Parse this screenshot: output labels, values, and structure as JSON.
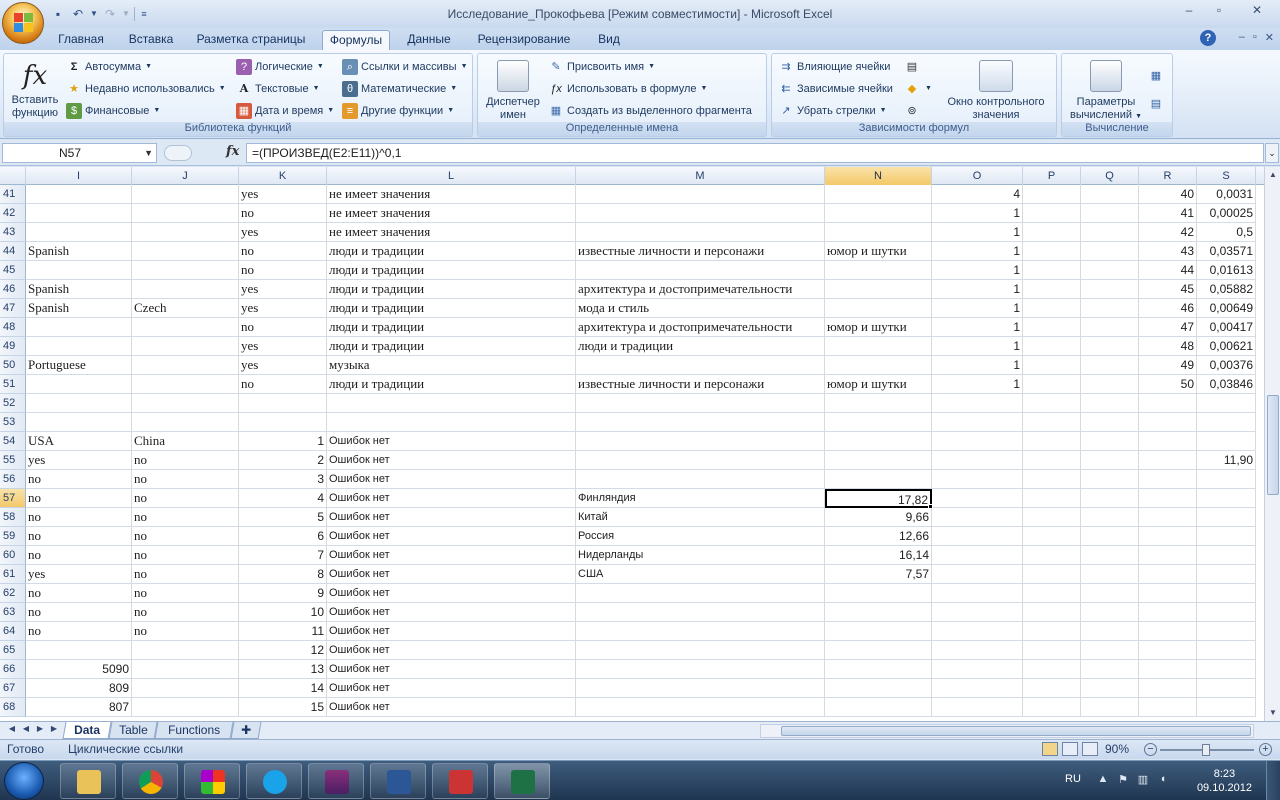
{
  "window": {
    "title": "Исследование_Прокофьева  [Режим совместимости] - Microsoft Excel",
    "controls": [
      "–",
      "▫",
      "✕"
    ]
  },
  "qat": {
    "save": "save-icon",
    "undo": "undo-icon",
    "redo": "redo-icon"
  },
  "tabs": [
    "Главная",
    "Вставка",
    "Разметка страницы",
    "Формулы",
    "Данные",
    "Рецензирование",
    "Вид"
  ],
  "active_tab": "Формулы",
  "ribbon": {
    "func_lib": {
      "label": "Библиотека функций",
      "insert_function": "Вставить функцию",
      "autosum": "Автосумма",
      "recent": "Недавно использовались",
      "financial": "Финансовые",
      "logical": "Логические",
      "text": "Текстовые",
      "datetime": "Дата и время",
      "lookup": "Ссылки и массивы",
      "math": "Математические",
      "other": "Другие функции"
    },
    "names": {
      "label": "Определенные имена",
      "name_manager_1": "Диспетчер",
      "name_manager_2": "имен",
      "define_name": "Присвоить имя",
      "use_in_formula": "Использовать в формуле",
      "create_from_sel": "Создать из выделенного фрагмента"
    },
    "auditing": {
      "label": "Зависимости формул",
      "precedents": "Влияющие ячейки",
      "dependents": "Зависимые ячейки",
      "remove_arrows": "Убрать стрелки",
      "watch_1": "Окно контрольного",
      "watch_2": "значения"
    },
    "calc": {
      "label": "Вычисление",
      "options_1": "Параметры",
      "options_2": "вычислений"
    }
  },
  "formula_bar": {
    "name_box": "N57",
    "formula": "=(ПРОИЗВЕД(E2:E11))^0,1"
  },
  "columns": [
    "I",
    "J",
    "K",
    "L",
    "M",
    "N",
    "O",
    "P",
    "Q",
    "R",
    "S"
  ],
  "selected_column": "N",
  "selected_row": "57",
  "rows": [
    {
      "n": "41",
      "K": "yes",
      "L": "не имеет значения",
      "O": "4",
      "R": "40",
      "S": "0,0031"
    },
    {
      "n": "42",
      "K": "no",
      "L": "не имеет значения",
      "O": "1",
      "R": "41",
      "S": "0,00025"
    },
    {
      "n": "43",
      "K": "yes",
      "L": "не имеет значения",
      "O": "1",
      "R": "42",
      "S": "0,5"
    },
    {
      "n": "44",
      "I": "Spanish",
      "K": "no",
      "L": "люди и традиции",
      "M": "известные личности и персонажи",
      "N": "юмор и шутки",
      "O": "1",
      "R": "43",
      "S": "0,03571"
    },
    {
      "n": "45",
      "K": "no",
      "L": "люди и традиции",
      "O": "1",
      "R": "44",
      "S": "0,01613"
    },
    {
      "n": "46",
      "I": "Spanish",
      "K": "yes",
      "L": "люди и традиции",
      "M": "архитектура и достопримечательности",
      "O": "1",
      "R": "45",
      "S": "0,05882"
    },
    {
      "n": "47",
      "I": "Spanish",
      "J": "Czech",
      "K": "yes",
      "L": "люди и традиции",
      "M": "мода и стиль",
      "O": "1",
      "R": "46",
      "S": "0,00649"
    },
    {
      "n": "48",
      "K": "no",
      "L": "люди и традиции",
      "M": "архитектура и достопримечательности",
      "N": "юмор и шутки",
      "O": "1",
      "R": "47",
      "S": "0,00417"
    },
    {
      "n": "49",
      "K": "yes",
      "L": "люди и традиции",
      "M": "люди и традиции",
      "O": "1",
      "R": "48",
      "S": "0,00621"
    },
    {
      "n": "50",
      "I": "Portuguese",
      "K": "yes",
      "L": "музыка",
      "O": "1",
      "R": "49",
      "S": "0,00376"
    },
    {
      "n": "51",
      "K": "no",
      "L": "люди и традиции",
      "M": "известные личности и персонажи",
      "N": "юмор и шутки",
      "O": "1",
      "R": "50",
      "S": "0,03846"
    },
    {
      "n": "52"
    },
    {
      "n": "53"
    },
    {
      "n": "54",
      "I": "USA",
      "J": "China",
      "K": "1",
      "L": "Ошибок нет"
    },
    {
      "n": "55",
      "I": "yes",
      "J": "no",
      "K": "2",
      "L": "Ошибок нет",
      "S": "11,90"
    },
    {
      "n": "56",
      "I": "no",
      "J": "no",
      "K": "3",
      "L": "Ошибок нет"
    },
    {
      "n": "57",
      "I": "no",
      "J": "no",
      "K": "4",
      "L": "Ошибок нет",
      "M": "Финляндия",
      "N": "17,82"
    },
    {
      "n": "58",
      "I": "no",
      "J": "no",
      "K": "5",
      "L": "Ошибок нет",
      "M": "Китай",
      "N": "9,66"
    },
    {
      "n": "59",
      "I": "no",
      "J": "no",
      "K": "6",
      "L": "Ошибок нет",
      "M": "Россия",
      "N": "12,66"
    },
    {
      "n": "60",
      "I": "no",
      "J": "no",
      "K": "7",
      "L": "Ошибок нет",
      "M": "Нидерланды",
      "N": "16,14"
    },
    {
      "n": "61",
      "I": "yes",
      "J": "no",
      "K": "8",
      "L": "Ошибок нет",
      "M": "США",
      "N": "7,57"
    },
    {
      "n": "62",
      "I": "no",
      "J": "no",
      "K": "9",
      "L": "Ошибок нет"
    },
    {
      "n": "63",
      "I": "no",
      "J": "no",
      "K": "10",
      "L": "Ошибок нет"
    },
    {
      "n": "64",
      "I": "no",
      "J": "no",
      "K": "11",
      "L": "Ошибок нет"
    },
    {
      "n": "65",
      "K": "12",
      "L": "Ошибок нет"
    },
    {
      "n": "66",
      "I": "5090",
      "K": "13",
      "L": "Ошибок нет"
    },
    {
      "n": "67",
      "I": "809",
      "K": "14",
      "L": "Ошибок нет"
    },
    {
      "n": "68",
      "I": "807",
      "K": "15",
      "L": "Ошибок нет"
    }
  ],
  "sheets": [
    "Data",
    "Table",
    "Functions"
  ],
  "active_sheet": "Data",
  "status": {
    "ready": "Готово",
    "circular": "Циклические ссылки",
    "zoom": "90%"
  },
  "tray": {
    "lang": "RU",
    "time": "8:23",
    "date": "09.10.2012"
  },
  "colors": {
    "accent": "#2b579a",
    "selection_header": "#f3c868",
    "ribbon": "#dbe6f4"
  }
}
